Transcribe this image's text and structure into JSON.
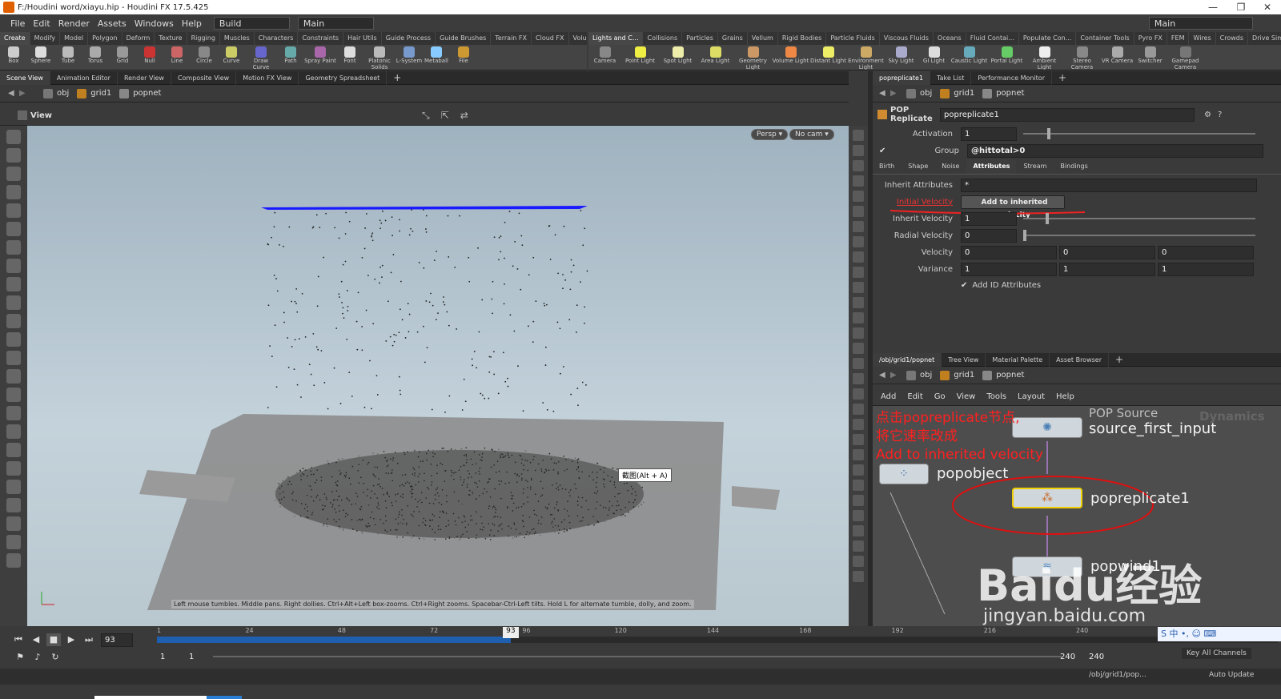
{
  "window": {
    "title": "F:/Houdini word/xiayu.hip - Houdini FX 17.5.425",
    "min": "—",
    "max": "❐",
    "close": "✕"
  },
  "menu": [
    "File",
    "Edit",
    "Render",
    "Assets",
    "Windows",
    "Help"
  ],
  "desktop": {
    "build": "Build",
    "main": "Main",
    "right_main": "Main"
  },
  "shelf_left": {
    "tabs": [
      "Create",
      "Modify",
      "Model",
      "Polygon",
      "Deform",
      "Texture",
      "Rigging",
      "Muscles",
      "Characters",
      "Constraints",
      "Hair Utils",
      "Guide Process",
      "Guide Brushes",
      "Terrain FX",
      "Cloud FX",
      "Volume"
    ],
    "tools": [
      "Box",
      "Sphere",
      "Tube",
      "Torus",
      "Grid",
      "Null",
      "Line",
      "Circle",
      "Curve",
      "Draw Curve",
      "Path",
      "Spray Paint",
      "Font",
      "Platonic Solids",
      "L-System",
      "Metaball",
      "File"
    ]
  },
  "shelf_right": {
    "tabs": [
      "Lights and C...",
      "Collisions",
      "Particles",
      "Grains",
      "Vellum",
      "Rigid Bodies",
      "Particle Fluids",
      "Viscous Fluids",
      "Oceans",
      "Fluid Contai...",
      "Populate Con...",
      "Container Tools",
      "Pyro FX",
      "FEM",
      "Wires",
      "Crowds",
      "Drive Simula..."
    ],
    "tools": [
      "Camera",
      "Point Light",
      "Spot Light",
      "Area Light",
      "Geometry Light",
      "Volume Light",
      "Distant Light",
      "Environment Light",
      "Sky Light",
      "GI Light",
      "Caustic Light",
      "Portal Light",
      "Ambient Light",
      "Stereo Camera",
      "VR Camera",
      "Switcher",
      "Gamepad Camera"
    ]
  },
  "left_panel": {
    "tabs": [
      "Scene View",
      "Animation Editor",
      "Render View",
      "Composite View",
      "Motion FX View",
      "Geometry Spreadsheet"
    ],
    "path": [
      "obj",
      "grid1",
      "popnet"
    ],
    "view_label": "View",
    "persp": "Persp ▾",
    "cam": "No cam ▾",
    "tooltip": "截图(Alt + A)",
    "status": "Left mouse tumbles. Middle pans. Right dollies. Ctrl+Alt+Left box-zooms. Ctrl+Right zooms. Spacebar-Ctrl-Left tilts. Hold L for alternate tumble, dolly, and zoom."
  },
  "parm_panel": {
    "tabs": [
      "popreplicate1",
      "Take List",
      "Performance Monitor"
    ],
    "path": [
      "obj",
      "grid1",
      "popnet"
    ],
    "node_type": "POP Replicate",
    "node_name": "popreplicate1",
    "activation_label": "Activation",
    "activation": "1",
    "group_label": "Group",
    "group": "@hittotal>0",
    "subtabs": [
      "Birth",
      "Shape",
      "Noise",
      "Attributes",
      "Stream",
      "Bindings"
    ],
    "inherit_attr_label": "Inherit Attributes",
    "inherit_attr": "*",
    "initial_velocity_label": "Initial Velocity",
    "initial_velocity": "Add to inherited velocity",
    "inherit_velocity_label": "Inherit Velocity",
    "inherit_velocity": "1",
    "radial_velocity_label": "Radial Velocity",
    "radial_velocity": "0",
    "velocity_label": "Velocity",
    "velocity": [
      "0",
      "0",
      "0"
    ],
    "variance_label": "Variance",
    "variance": [
      "1",
      "1",
      "1"
    ],
    "add_id_label": "Add ID Attributes"
  },
  "network_panel": {
    "tabs": [
      "/obj/grid1/popnet",
      "Tree View",
      "Material Palette",
      "Asset Browser"
    ],
    "path": [
      "obj",
      "grid1",
      "popnet"
    ],
    "menu": [
      "Add",
      "Edit",
      "Go",
      "View",
      "Tools",
      "Layout",
      "Help"
    ],
    "context": "Dynamics",
    "annotation": [
      "点击popreplicate节点,",
      "将它速率改成",
      "Add to inherited velocity"
    ],
    "nodes": {
      "source_type": "POP Source",
      "source": "source_first_input",
      "popobject": "popobject",
      "replicate": "popreplicate1",
      "wind": "popwind1"
    }
  },
  "timeline": {
    "frame": "93",
    "ticks": [
      "1",
      "24",
      "48",
      "72",
      "96",
      "120",
      "144",
      "168",
      "192",
      "216",
      "240"
    ],
    "start": "1",
    "start2": "1",
    "end": "240",
    "end2": "240",
    "key_all": "Key All Channels",
    "auto_update": "Auto Update",
    "net_path": "/obj/grid1/pop..."
  },
  "watermark": {
    "brand": "Baidu经验",
    "url": "jingyan.baidu.com"
  },
  "ime": "S 中 •, ☺ ⌨"
}
